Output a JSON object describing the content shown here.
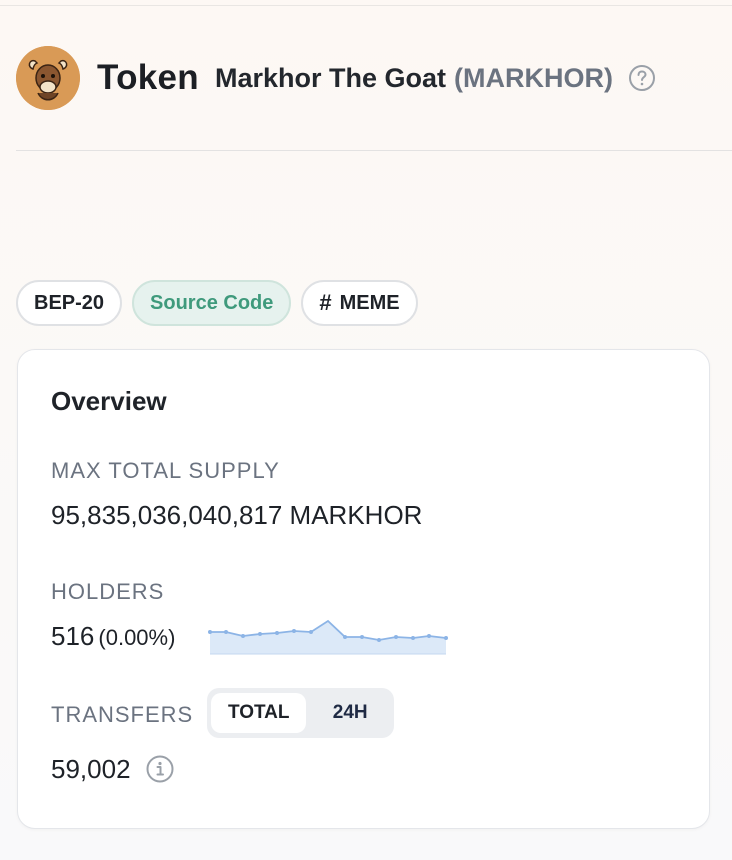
{
  "header": {
    "token_label": "Token",
    "name": "Markhor The Goat",
    "symbol": "(MARKHOR)",
    "avatar_icon": "goat-logo-icon",
    "help_icon": "question-circle-icon"
  },
  "tags": [
    {
      "label": "BEP-20"
    },
    {
      "label": "Source Code"
    },
    {
      "label": "MEME",
      "prefix": "#"
    }
  ],
  "overview": {
    "title": "Overview",
    "max_supply": {
      "label": "MAX TOTAL SUPPLY",
      "value": "95,835,036,040,817 MARKHOR"
    },
    "holders": {
      "label": "HOLDERS",
      "value": "516",
      "change": "(0.00%)"
    },
    "transfers": {
      "label": "TRANSFERS",
      "value": "59,002",
      "tabs": [
        "TOTAL",
        "24H"
      ],
      "active_tab": "TOTAL",
      "info_icon": "info-circle-icon"
    }
  },
  "colors": {
    "source_code_text": "#3f9a7c",
    "sparkline_line": "#8cb4e6",
    "sparkline_fill": "#dce9f8"
  }
}
